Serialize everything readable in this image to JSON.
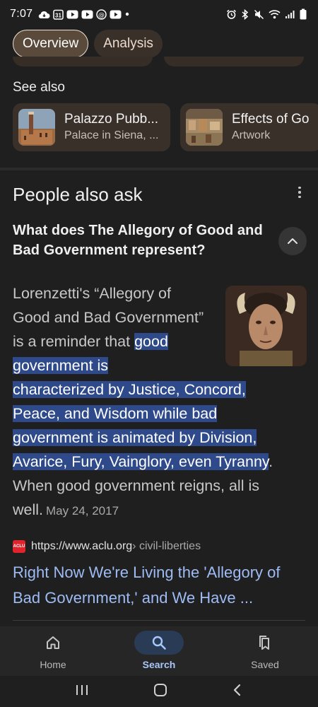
{
  "status_bar": {
    "time": "7:07",
    "left_icons": [
      "cloud-icon",
      "calendar-31-icon",
      "youtube-icon",
      "youtube-icon",
      "threads-icon",
      "youtube-icon",
      "dot-icon"
    ],
    "right_icons": [
      "alarm-icon",
      "bluetooth-icon",
      "mute-icon",
      "wifi-icon",
      "signal-icon",
      "battery-icon"
    ],
    "calendar_day": "31"
  },
  "tabs": [
    {
      "label": "Overview",
      "active": true
    },
    {
      "label": "Analysis",
      "active": false
    }
  ],
  "see_also": {
    "title": "See also",
    "items": [
      {
        "title": "Palazzo Pubb...",
        "subtitle": "Palace in Siena, ..."
      },
      {
        "title": "Effects of Go",
        "subtitle": "Artwork"
      }
    ]
  },
  "people_also_ask": {
    "title": "People also ask",
    "question": "What does The Allegory of Good and Bad Government represent?",
    "answer_lines": [
      {
        "plain": "Lorenzetti's “Allegory of",
        "hl": ""
      },
      {
        "plain": "Good and Bad Government”",
        "hl": ""
      },
      {
        "plain": "is a reminder that ",
        "hl": "good"
      },
      {
        "plain": "",
        "hl": "government is"
      },
      {
        "plain": "",
        "hl": "characterized by Justice, Concord,"
      },
      {
        "plain": "",
        "hl": "Peace, and Wisdom while bad"
      },
      {
        "plain": "",
        "hl": "government is animated by Division,"
      },
      {
        "plain": "",
        "hl": "Avarice, Fury, Vainglory, even Tyranny",
        "after": "."
      },
      {
        "plain": "When good government reigns, all is",
        "hl": ""
      },
      {
        "plain": "well.",
        "hl": "",
        "date": "May 24, 2017"
      }
    ],
    "source": {
      "favicon_text": "ACLU",
      "url": "https://www.aclu.org",
      "path": " › civil-liberties"
    },
    "result_title": "Right Now We're Living the 'Allegory of Bad Government,' and We Have ..."
  },
  "bottom_nav": [
    {
      "label": "Home",
      "icon": "home-icon",
      "active": false
    },
    {
      "label": "Search",
      "icon": "search-icon",
      "active": true
    },
    {
      "label": "Saved",
      "icon": "bookmarks-icon",
      "active": false
    }
  ],
  "colors": {
    "background": "#1f1f1f",
    "highlight": "#2f4a8a",
    "link": "#9dbcf5",
    "tab_active_border": "#efe0cf",
    "nav_active": "#a8c7fa"
  }
}
